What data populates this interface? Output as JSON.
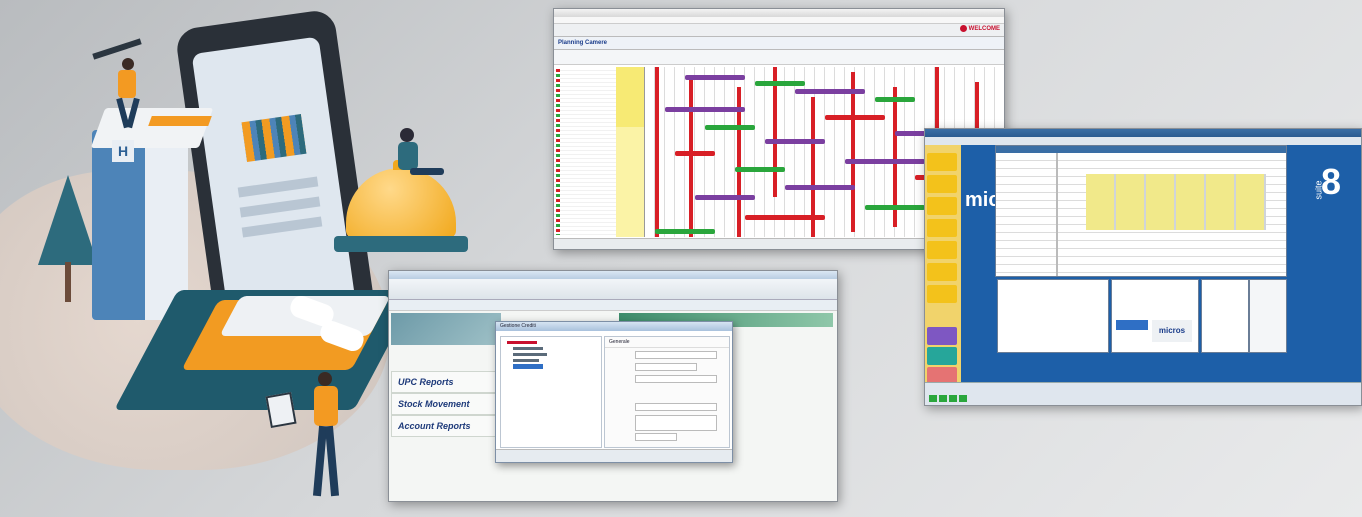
{
  "planning_window": {
    "title": "Planning Camere",
    "brand": "WELCOME"
  },
  "stock_window": {
    "sections": [
      "Stock Movement",
      "Account Reports",
      "UPC Reports"
    ],
    "dialog_title": "Gestione Crediti",
    "dialog_tab": "Generale"
  },
  "suite8_window": {
    "logo_text": "micros",
    "suite_text": "suite",
    "suite_number": "8"
  },
  "colors": {
    "accent_orange": "#f39a22",
    "teal": "#2d6b7d",
    "hotel_blue": "#4d84b8",
    "suite8_blue": "#1d5fa8",
    "gantt_purple": "#7b3fa0",
    "gantt_green": "#2aa63c",
    "gantt_red": "#d81f26"
  },
  "icons": [
    "hotel-building-icon",
    "smartphone-icon",
    "reception-bell-icon",
    "bed-icon",
    "tree-icon",
    "person-with-telescope-icon",
    "person-on-bell-icon",
    "person-with-tablet-icon"
  ]
}
